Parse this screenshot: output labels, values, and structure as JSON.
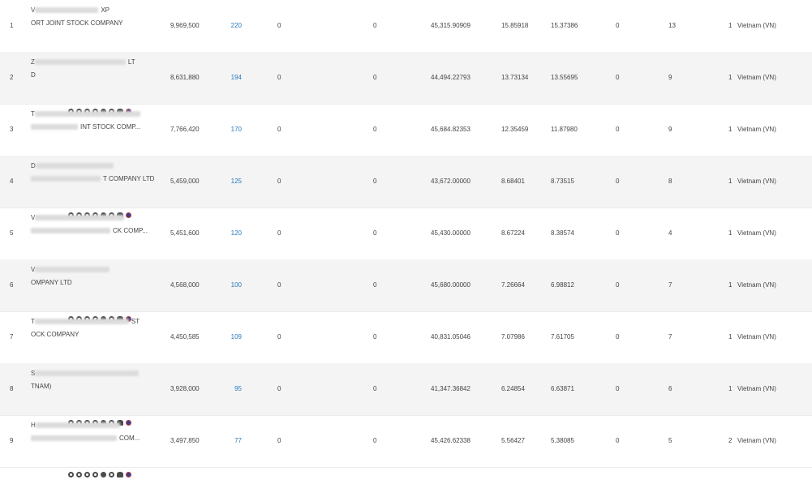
{
  "rows": [
    {
      "idx": "1",
      "l1_pre": "V",
      "l1_suf": "XP",
      "l2_pre": "ORT JOINT STOCK COMPANY",
      "l2_suf": "",
      "v1": "9,969,500",
      "v2": "220",
      "v3": "0",
      "v4": "0",
      "v5": "45,315.90909",
      "v6": "15.85918",
      "v7": "15.37386",
      "v8": "0",
      "v9": "13",
      "v10": "1",
      "v11": "Vietnam (VN)"
    },
    {
      "idx": "2",
      "l1_pre": "Z",
      "l1_suf": "LT",
      "l2_pre": "D",
      "l2_suf": "",
      "v1": "8,631,880",
      "v2": "194",
      "v3": "0",
      "v4": "0",
      "v5": "44,494.22793",
      "v6": "13.73134",
      "v7": "13.55695",
      "v8": "0",
      "v9": "9",
      "v10": "1",
      "v11": "Vietnam (VN)"
    },
    {
      "idx": "3",
      "l1_pre": "T",
      "l1_suf": "",
      "l2_pre": "",
      "l2_suf": "INT STOCK COMP...",
      "v1": "7,766,420",
      "v2": "170",
      "v3": "0",
      "v4": "0",
      "v5": "45,684.82353",
      "v6": "12.35459",
      "v7": "11.87980",
      "v8": "0",
      "v9": "9",
      "v10": "1",
      "v11": "Vietnam (VN)"
    },
    {
      "idx": "4",
      "l1_pre": "D",
      "l1_suf": "",
      "l2_pre": "",
      "l2_suf": "T COMPANY LTD",
      "v1": "5,459,000",
      "v2": "125",
      "v3": "0",
      "v4": "0",
      "v5": "43,672.00000",
      "v6": "8.68401",
      "v7": "8.73515",
      "v8": "0",
      "v9": "8",
      "v10": "1",
      "v11": "Vietnam (VN)"
    },
    {
      "idx": "5",
      "l1_pre": "V",
      "l1_suf": "",
      "l2_pre": "",
      "l2_suf": "CK COMP...",
      "v1": "5,451,600",
      "v2": "120",
      "v3": "0",
      "v4": "0",
      "v5": "45,430.00000",
      "v6": "8.67224",
      "v7": "8.38574",
      "v8": "0",
      "v9": "4",
      "v10": "1",
      "v11": "Vietnam (VN)"
    },
    {
      "idx": "6",
      "l1_pre": "V",
      "l1_suf": "",
      "l2_pre": "OMPANY LTD",
      "l2_suf": "",
      "v1": "4,568,000",
      "v2": "100",
      "v3": "0",
      "v4": "0",
      "v5": "45,680.00000",
      "v6": "7.26664",
      "v7": "6.98812",
      "v8": "0",
      "v9": "7",
      "v10": "1",
      "v11": "Vietnam (VN)"
    },
    {
      "idx": "7",
      "l1_pre": "T",
      "l1_suf": "ST",
      "l2_pre": "OCK COMPANY",
      "l2_suf": "",
      "v1": "4,450,585",
      "v2": "109",
      "v3": "0",
      "v4": "0",
      "v5": "40,831.05046",
      "v6": "7.07986",
      "v7": "7.61705",
      "v8": "0",
      "v9": "7",
      "v10": "1",
      "v11": "Vietnam (VN)"
    },
    {
      "idx": "8",
      "l1_pre": "S",
      "l1_suf": "",
      "l2_pre": "TNAM)",
      "l2_suf": "",
      "v1": "3,928,000",
      "v2": "95",
      "v3": "0",
      "v4": "0",
      "v5": "41,347.36842",
      "v6": "6.24854",
      "v7": "6.63871",
      "v8": "0",
      "v9": "6",
      "v10": "1",
      "v11": "Vietnam (VN)"
    },
    {
      "idx": "9",
      "l1_pre": "H",
      "l1_suf": "",
      "l2_pre": "",
      "l2_suf": "COM...",
      "v1": "3,497,850",
      "v2": "77",
      "v3": "0",
      "v4": "0",
      "v5": "45,426.62338",
      "v6": "5.56427",
      "v7": "5.38085",
      "v8": "0",
      "v9": "5",
      "v10": "2",
      "v11": "Vietnam (VN)"
    }
  ],
  "icons": [
    "target-icon",
    "globe-icon",
    "chart-icon",
    "lock-icon",
    "circle-icon",
    "info-icon",
    "people-icon",
    "flag-icon"
  ]
}
